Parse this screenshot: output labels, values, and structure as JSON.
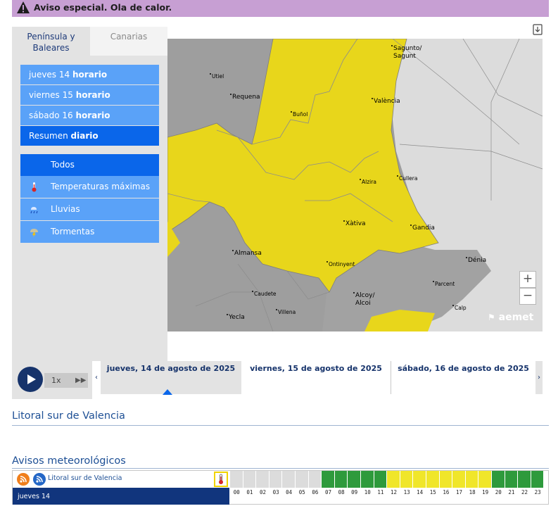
{
  "alert": {
    "text": "Aviso especial. Ola de calor."
  },
  "region_tabs": [
    {
      "label": "Península y Baleares",
      "active": true
    },
    {
      "label": "Canarias",
      "active": false
    }
  ],
  "days": [
    {
      "prefix": "jueves 14",
      "suffix": "horario",
      "active": false
    },
    {
      "prefix": "viernes 15",
      "suffix": "horario",
      "active": false
    },
    {
      "prefix": "sábado 16",
      "suffix": "horario",
      "active": false
    },
    {
      "prefix": "Resumen",
      "suffix": "diario",
      "active": true
    }
  ],
  "filters": [
    {
      "label": "Todos",
      "icon": "none",
      "active": true
    },
    {
      "label": "Temperaturas máximas",
      "icon": "thermometer-icon",
      "active": false
    },
    {
      "label": "Lluvias",
      "icon": "rain-icon",
      "active": false
    },
    {
      "label": "Tormentas",
      "icon": "storm-icon",
      "active": false
    }
  ],
  "map": {
    "towns": {
      "sagunto": "Sagunto/ Sagunt",
      "utiel": "Utiel",
      "requena": "Requena",
      "valencia": "València",
      "bunol": "Buñol",
      "cullera": "Cullera",
      "alzira": "Alzira",
      "xativa": "Xàtiva",
      "gandia": "Gandia",
      "almansa": "Almansa",
      "ontinyent": "Ontinyent",
      "denia": "Dénia",
      "parcent": "Parcent",
      "caudete": "Caudete",
      "alcoy": "Alcoy/ Alcoi",
      "villena": "Villena",
      "calp": "Calp",
      "yecla": "Yecla"
    },
    "zoom_in": "+",
    "zoom_out": "−",
    "logo": "aemet",
    "warning_color": "#e8d61b",
    "land_color": "#9e9e9e",
    "sea_color": "#dcdcdc"
  },
  "timeline": {
    "speed": "1x",
    "ff": "▶▶",
    "prev": "‹",
    "next": "›",
    "days": [
      {
        "label": "jueves, 14 de agosto de 2025",
        "selected": true
      },
      {
        "label": "viernes, 15 de agosto de 2025",
        "selected": false
      },
      {
        "label": "sábado, 16 de agosto de 2025",
        "selected": false
      }
    ]
  },
  "zone_title": "Litoral sur de Valencia",
  "warnings": {
    "title": "Avisos meteorológicos",
    "zone": "Litoral sur de Valencia",
    "day": "jueves 14",
    "hours": [
      "00",
      "01",
      "02",
      "03",
      "04",
      "05",
      "06",
      "07",
      "08",
      "09",
      "10",
      "11",
      "12",
      "13",
      "14",
      "15",
      "16",
      "17",
      "18",
      "19",
      "20",
      "21",
      "22",
      "23"
    ],
    "levels": [
      "none",
      "none",
      "none",
      "none",
      "none",
      "none",
      "none",
      "green",
      "green",
      "green",
      "green",
      "green",
      "yellow",
      "yellow",
      "yellow",
      "yellow",
      "yellow",
      "yellow",
      "yellow",
      "yellow",
      "green",
      "green",
      "green",
      "green"
    ],
    "level_colors": {
      "none": "#dcdcdc",
      "green": "#2e9a3c",
      "yellow": "#f0e62a"
    }
  }
}
